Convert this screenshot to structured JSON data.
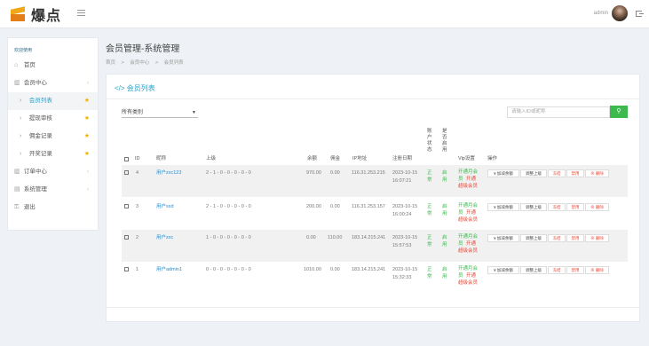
{
  "header": {
    "brand": "爆点",
    "user": "admin"
  },
  "sidebar": {
    "section": "欢迎使用",
    "items": [
      {
        "icon": "⌂",
        "label": "首页"
      },
      {
        "icon": "▥",
        "label": "会员中心",
        "chevron": "›"
      },
      {
        "icon": "›",
        "label": "会员列表",
        "star": "★"
      },
      {
        "icon": "›",
        "label": "提现审核",
        "star": "★"
      },
      {
        "icon": "›",
        "label": "佣金记录",
        "star": "★"
      },
      {
        "icon": "›",
        "label": "开奖记录",
        "star": "★"
      },
      {
        "icon": "▥",
        "label": "订单中心",
        "chevron": "›"
      },
      {
        "icon": "▤",
        "label": "系统管理",
        "chevron": "›"
      },
      {
        "icon": "⚿",
        "label": "退出"
      }
    ]
  },
  "page": {
    "title": "会员管理-系统管理",
    "breadcrumb": [
      "首页",
      ">",
      "会员中心",
      ">",
      "会员列表"
    ]
  },
  "card": {
    "title": "</> 会员列表",
    "select_value": "所有类别",
    "search_placeholder": "请输入ID或昵称",
    "search_icon": "⚲"
  },
  "table": {
    "headers": {
      "id": "ID",
      "nickname": "昵称",
      "superior": "上级",
      "balance": "余额",
      "commission": "佣金",
      "ip": "IP地址",
      "reg_date": "注册日期",
      "account_status": "账户状态",
      "is_enabled": "是否启用",
      "vip": "Vip设置",
      "actions": "操作"
    },
    "rows": [
      {
        "id": "4",
        "nickname": "用户zxc123",
        "superior": "2 - 1 - 0 - 0 - 0 - 0 - 0",
        "balance": "970.00",
        "commission": "0.00",
        "ip": "116.31.253.215",
        "date": "2023-10-15",
        "time": "16:07:21",
        "status": "正常",
        "enabled": "启用"
      },
      {
        "id": "3",
        "nickname": "用户sxd",
        "superior": "2 - 1 - 0 - 0 - 0 - 0 - 0",
        "balance": "200.00",
        "commission": "0.00",
        "ip": "116.31.253.157",
        "date": "2023-10-15",
        "time": "16:00:24",
        "status": "正常",
        "enabled": "启用"
      },
      {
        "id": "2",
        "nickname": "用户zxc",
        "superior": "1 - 0 - 0 - 0 - 0 - 0 - 0",
        "balance": "0.00",
        "commission": "110.00",
        "ip": "183.14.215.241",
        "date": "2023-10-15",
        "time": "15:57:53",
        "status": "正常",
        "enabled": "启用"
      },
      {
        "id": "1",
        "nickname": "用户admin1",
        "superior": "0 - 0 - 0 - 0 - 0 - 0 - 0",
        "balance": "1010.00",
        "commission": "0.00",
        "ip": "183.14.215.241",
        "date": "2023-10-15",
        "time": "15:32:33",
        "status": "正常",
        "enabled": "启用"
      }
    ],
    "vip_labels": {
      "month_a": "开通月会",
      "month_b": "员",
      "open": "开通",
      "super": "超级会员"
    },
    "action_labels": {
      "balance": "¥ 加减余额",
      "superior": "调整上级",
      "freeze": "冻结",
      "disable": "禁用",
      "delete": "⊗ 删除"
    }
  }
}
